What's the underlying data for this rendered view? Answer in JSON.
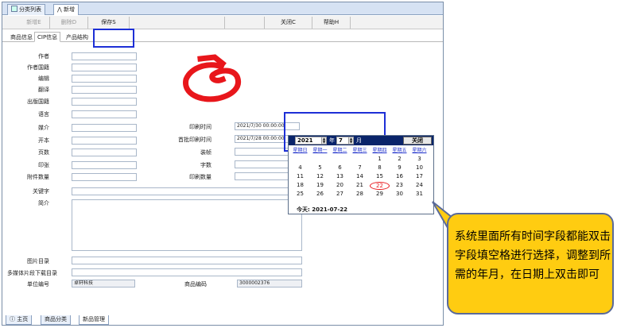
{
  "top_tabs": [
    {
      "label": "分类列表"
    },
    {
      "label": "新增"
    }
  ],
  "toolbar": {
    "add": "新增E",
    "delete": "删除D",
    "save": "保存S",
    "close": "关闭C",
    "help": "帮助H"
  },
  "subtabs": [
    {
      "label": "商品信息"
    },
    {
      "label": "CIP信息"
    },
    {
      "label": "产品结构"
    }
  ],
  "form": {
    "author": "作者",
    "author_country": "作者国籍",
    "editor": "编辑",
    "translator": "翻译",
    "pub_country": "出版国籍",
    "language": "语言",
    "medium": "媒介",
    "format": "开本",
    "pages": "页数",
    "print_sheets": "印张",
    "attachments": "附件数量",
    "keywords": "关键字",
    "summary": "简介",
    "image_catalog": "图片目录",
    "media_url": "多媒体片段下载目录",
    "unit_code_label": "单位编号",
    "unit_code_value": "卓轩科技",
    "product_code_label": "商品编码",
    "product_code_value": "3000002376",
    "print_time_label": "印刷时间",
    "print_time_value": "2021/7/30 00:00:00",
    "first_print_label": "首批印刷时间",
    "first_print_value": "2021/7/28 00:00:00",
    "binding": "装帧",
    "word_count": "字数",
    "print_qty": "印刷数量"
  },
  "calendar": {
    "year": "2021",
    "year_unit": "年",
    "month": "7",
    "month_unit": "月",
    "close": "关闭",
    "weekdays": [
      "星期日",
      "星期一",
      "星期二",
      "星期三",
      "星期四",
      "星期五",
      "星期六"
    ],
    "weeks": [
      [
        "",
        "",
        "",
        "",
        "1",
        "2",
        "3"
      ],
      [
        "4",
        "5",
        "6",
        "7",
        "8",
        "9",
        "10"
      ],
      [
        "11",
        "12",
        "13",
        "14",
        "15",
        "16",
        "17"
      ],
      [
        "18",
        "19",
        "20",
        "21",
        "22",
        "23",
        "24"
      ],
      [
        "25",
        "26",
        "27",
        "28",
        "29",
        "30",
        "31"
      ]
    ],
    "selected_day": "22",
    "today": "今天: 2021-07-22"
  },
  "bottom_tabs": [
    {
      "label": "主页"
    },
    {
      "label": "商品分类"
    },
    {
      "label": "新品管理"
    }
  ],
  "callout": {
    "text": "系统里面所有时间字段都能双击字段填空格进行选择，调整到所需的年月，在日期上双击即可"
  },
  "colors": {
    "highlight_box": "#1d2fd6",
    "callout_bg": "#ffcc11",
    "scribble": "#e8161b",
    "calendar_header": "#0a246a"
  }
}
